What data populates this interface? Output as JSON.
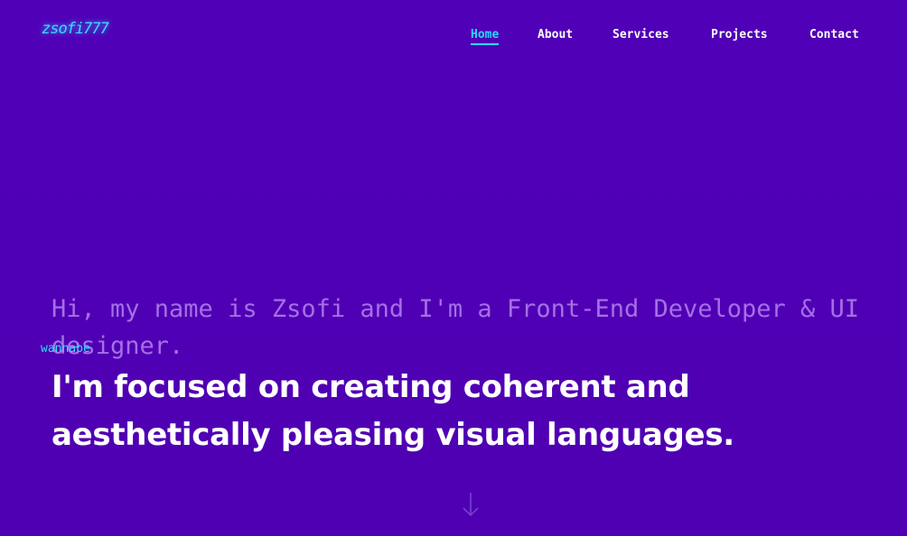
{
  "brand": {
    "logo_text": "zsofi777"
  },
  "nav": {
    "items": [
      {
        "label": "Home",
        "active": true
      },
      {
        "label": "About",
        "active": false
      },
      {
        "label": "Services",
        "active": false
      },
      {
        "label": "Projects",
        "active": false
      },
      {
        "label": "Contact",
        "active": false
      }
    ]
  },
  "hero": {
    "intro": "Hi, my name is Zsofi and I'm a Front-End Developer & UI designer.",
    "intro_tag": "wannabe",
    "headline": "I'm focused on creating coherent and aesthetically pleasing visual languages.",
    "scroll_icon": "arrow-down-icon"
  },
  "colors": {
    "background": "#5000b6",
    "accent": "#29d6ff",
    "intro_text": "#a56fe6",
    "headline_text": "#ffffff"
  }
}
